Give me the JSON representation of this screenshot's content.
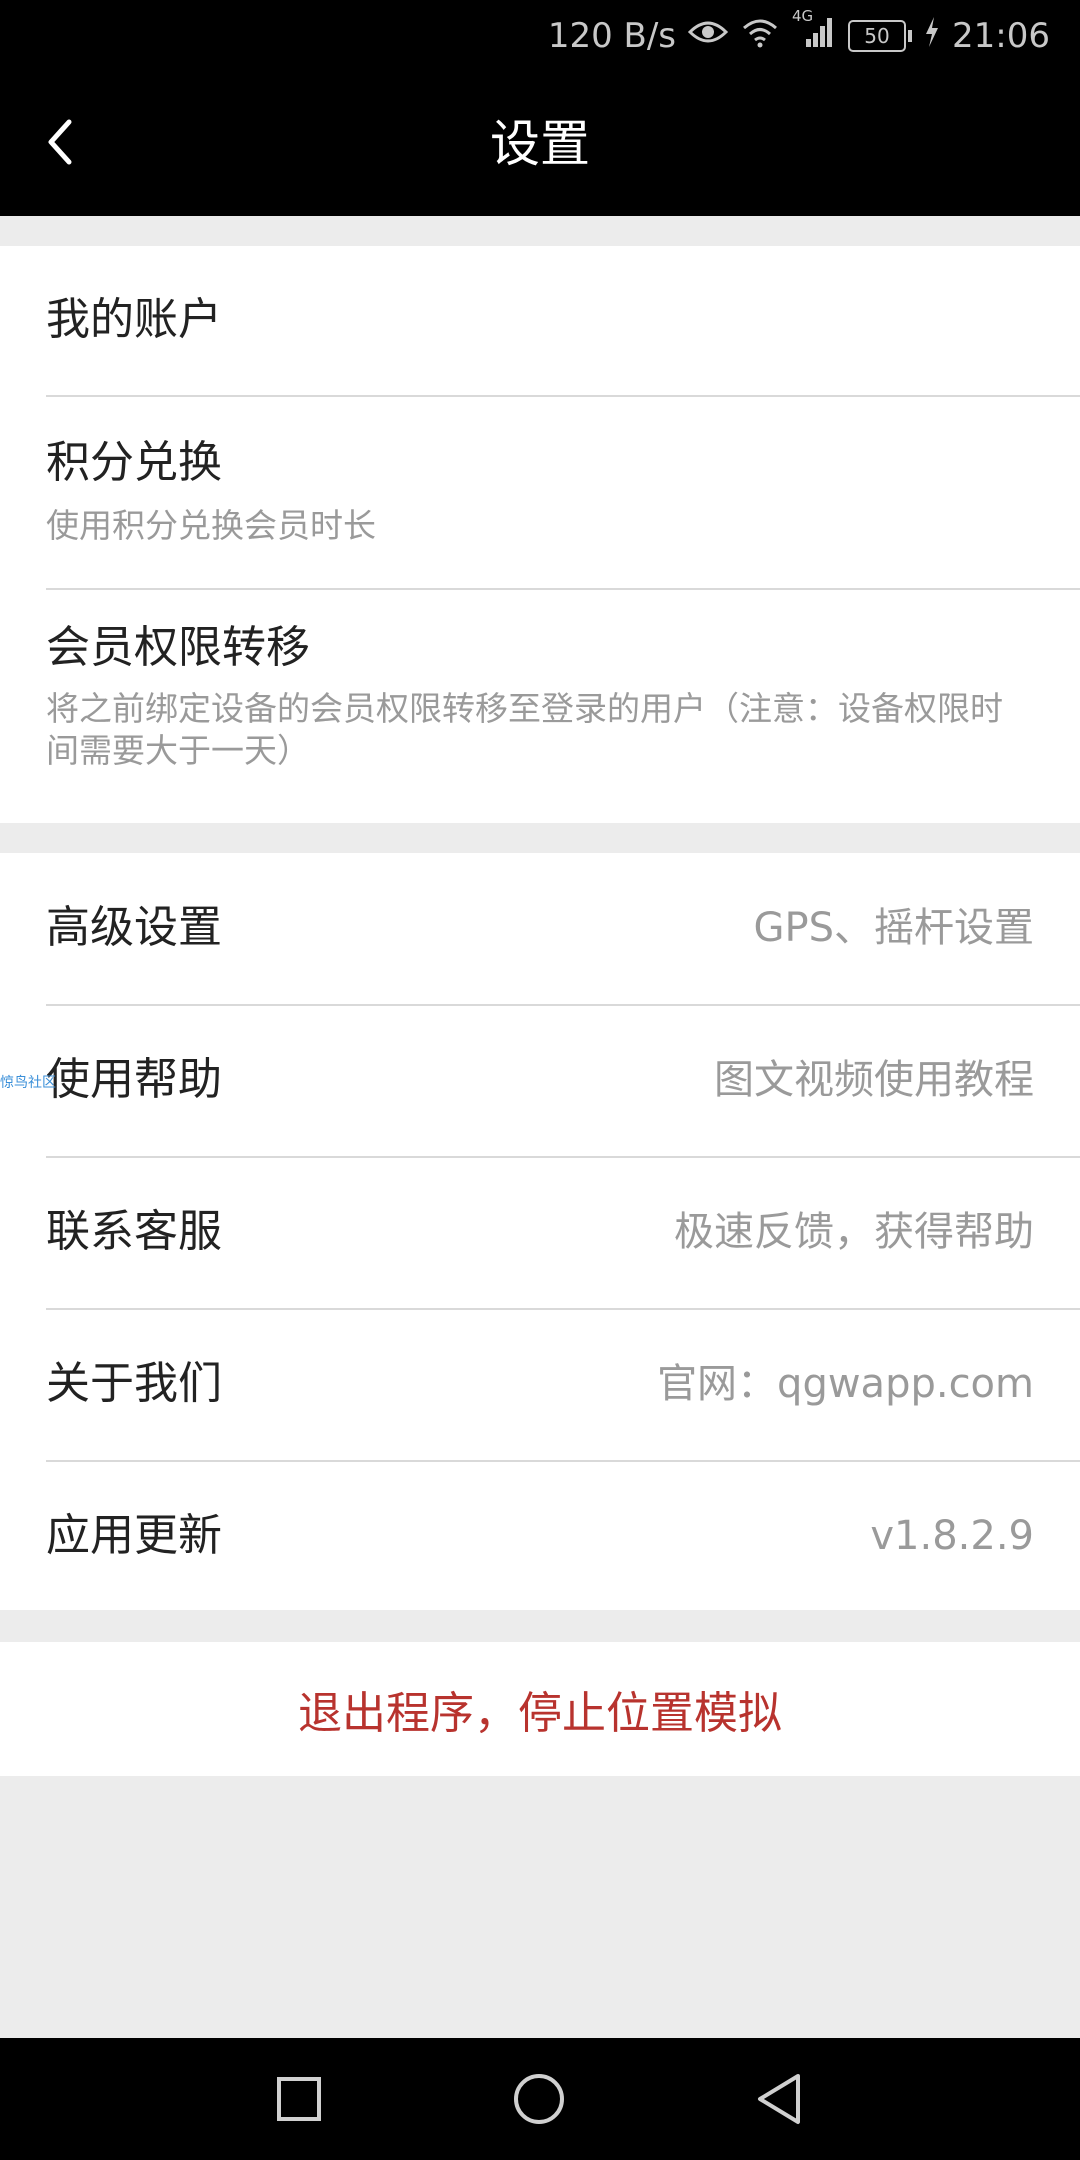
{
  "status_bar": {
    "speed": "120 B/s",
    "network": "4G",
    "battery": "50",
    "time": "21:06",
    "icons": [
      "eye-icon",
      "wifi-icon",
      "signal-icon",
      "battery-icon",
      "charging-icon"
    ]
  },
  "header": {
    "title": "设置",
    "back_icon": "back-icon"
  },
  "section1": {
    "items": [
      {
        "label": "我的账户"
      },
      {
        "label": "积分兑换",
        "sub": "使用积分兑换会员时长"
      },
      {
        "label": "会员权限转移",
        "sub": "将之前绑定设备的会员权限转移至登录的用户（注意：设备权限时间需要大于一天）"
      }
    ]
  },
  "section2": {
    "items": [
      {
        "label": "高级设置",
        "value": "GPS、摇杆设置"
      },
      {
        "label": "使用帮助",
        "value": "图文视频使用教程"
      },
      {
        "label": "联系客服",
        "value": "极速反馈，获得帮助"
      },
      {
        "label": "关于我们",
        "value": "官网：qgwapp.com"
      },
      {
        "label": "应用更新",
        "value": "v1.8.2.9"
      }
    ]
  },
  "logout": {
    "label": "退出程序，停止位置模拟"
  },
  "watermark": "惊鸟社区",
  "nav_bar": {
    "icons": [
      "recents-icon",
      "home-icon",
      "back-nav-icon"
    ]
  },
  "colors": {
    "accent": "#b8332e",
    "header_bg": "#000000",
    "page_bg": "#ececec"
  }
}
